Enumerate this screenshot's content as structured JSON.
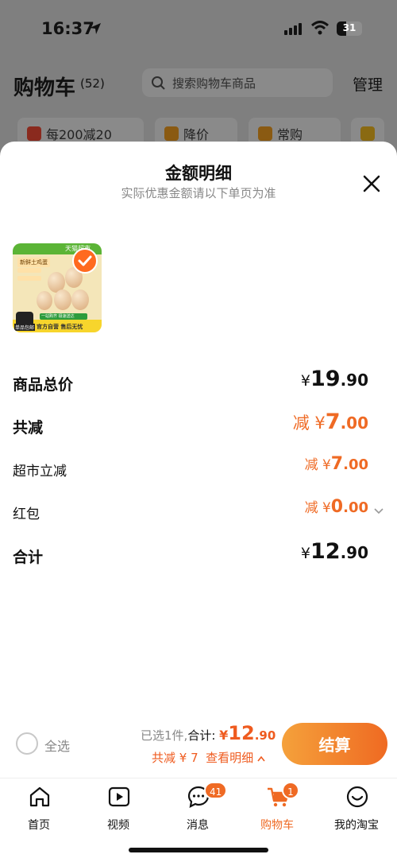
{
  "status_bar": {
    "time": "16:37",
    "battery": "31"
  },
  "header": {
    "title": "购物车",
    "count": "(52)",
    "search_placeholder": "搜索购物车商品",
    "manage": "管理"
  },
  "chips": [
    {
      "label": "每200减20"
    },
    {
      "label": "降价"
    },
    {
      "label": "常购"
    }
  ],
  "sheet": {
    "title": "金额明细",
    "subtitle": "实际优惠金额请以下单页为准",
    "product": {
      "store_tag": "天猫超市",
      "tag": "新鲜土鸡蛋",
      "bottom_text": "官方自营 售后无忧",
      "green_text": "一站购齐 极速送达",
      "cat_text": "单品包邮"
    },
    "rows": [
      {
        "label": "商品总价",
        "prefix": "¥",
        "int": "19",
        "dec": ".90"
      },
      {
        "label": "共减",
        "prefix": "减 ¥",
        "int": "7",
        "dec": ".00"
      },
      {
        "label": "超市立减",
        "prefix": "减 ¥",
        "int": "7",
        "dec": ".00"
      },
      {
        "label": "红包",
        "prefix": "减 ¥",
        "int": "0",
        "dec": ".00"
      },
      {
        "label": "合计",
        "prefix": "¥",
        "int": "12",
        "dec": ".90"
      }
    ]
  },
  "checkout": {
    "select_all": "全选",
    "selected_text": "已选1件,",
    "total_label": "合计:",
    "currency": "¥",
    "total_int": "12",
    "total_dec": ".90",
    "discount_text": "共减 ¥ 7",
    "detail_link": "查看明细",
    "pay_button": "结算"
  },
  "tabs": [
    {
      "label": "首页"
    },
    {
      "label": "视频"
    },
    {
      "label": "消息",
      "badge": "41"
    },
    {
      "label": "购物车",
      "badge": "1"
    },
    {
      "label": "我的淘宝"
    }
  ],
  "colors": {
    "accent": "#ef6a24",
    "modal_bg": "#ffffff",
    "overlay": "#7f7f7f"
  }
}
